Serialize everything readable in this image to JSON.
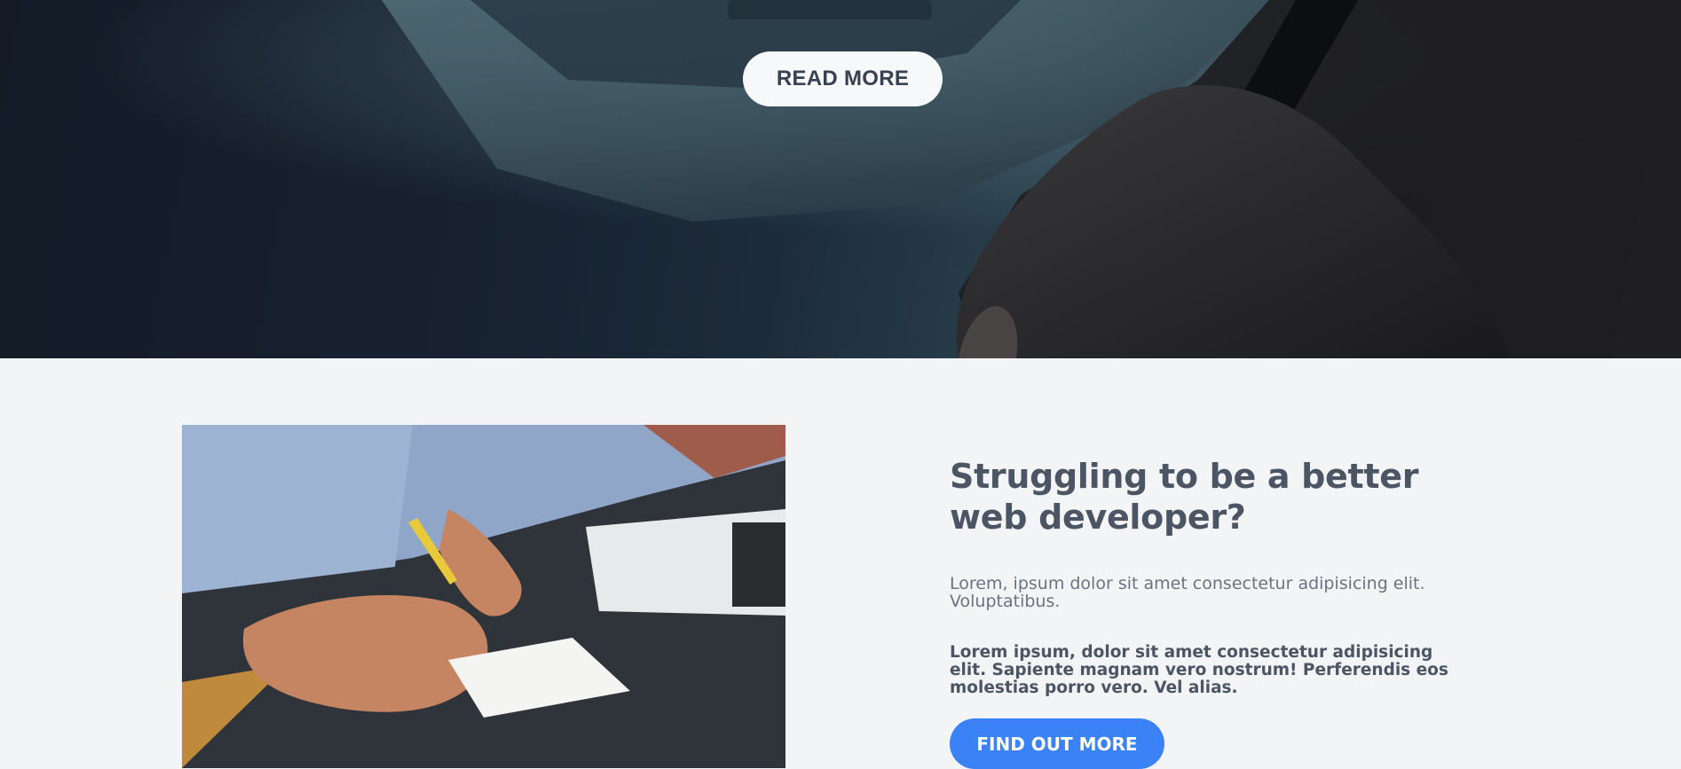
{
  "hero": {
    "read_more_label": "READ MORE"
  },
  "feature": {
    "heading": "Struggling to be a better web developer?",
    "lead": "Lorem, ipsum dolor sit amet consectetur adipisicing elit. Voluptatibus.",
    "bold_text": "Lorem ipsum, dolor sit amet consectetur adipisicing elit. Sapiente magnam vero nostrum! Perferendis eos molestias porro vero. Vel alias.",
    "cta_label": "FIND OUT MORE"
  },
  "colors": {
    "page_background": "#f3f4f6",
    "cta_accent": "#3b82f6",
    "heading_text": "#4b5563"
  }
}
